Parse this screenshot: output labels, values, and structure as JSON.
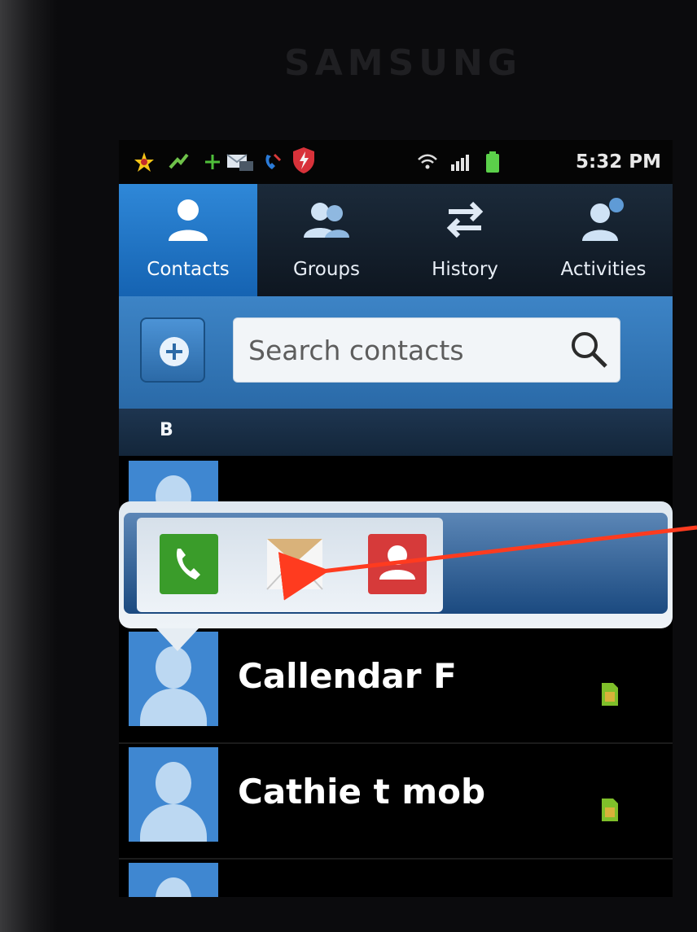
{
  "device": {
    "brand": "SAMSUNG"
  },
  "status_bar": {
    "time": "5:32 PM"
  },
  "tabs": [
    {
      "label": "Contacts",
      "icon": "contact-icon",
      "active": true
    },
    {
      "label": "Groups",
      "icon": "groups-icon",
      "active": false
    },
    {
      "label": "History",
      "icon": "history-icon",
      "active": false
    },
    {
      "label": "Activities",
      "icon": "activities-icon",
      "active": false
    }
  ],
  "search": {
    "placeholder": "Search contacts"
  },
  "section_header": "B",
  "contacts": [
    {
      "name": "Callendar F"
    },
    {
      "name": "Cathie t mob"
    }
  ],
  "quick_actions": [
    {
      "icon": "phone-icon",
      "color": "#3a9c2a"
    },
    {
      "icon": "message-icon",
      "color": "#d9c29a"
    },
    {
      "icon": "contact-card-icon",
      "color": "#d63a3a"
    }
  ],
  "colors": {
    "accent": "#2f88d8",
    "annotation_arrow": "#ff3b1f"
  }
}
